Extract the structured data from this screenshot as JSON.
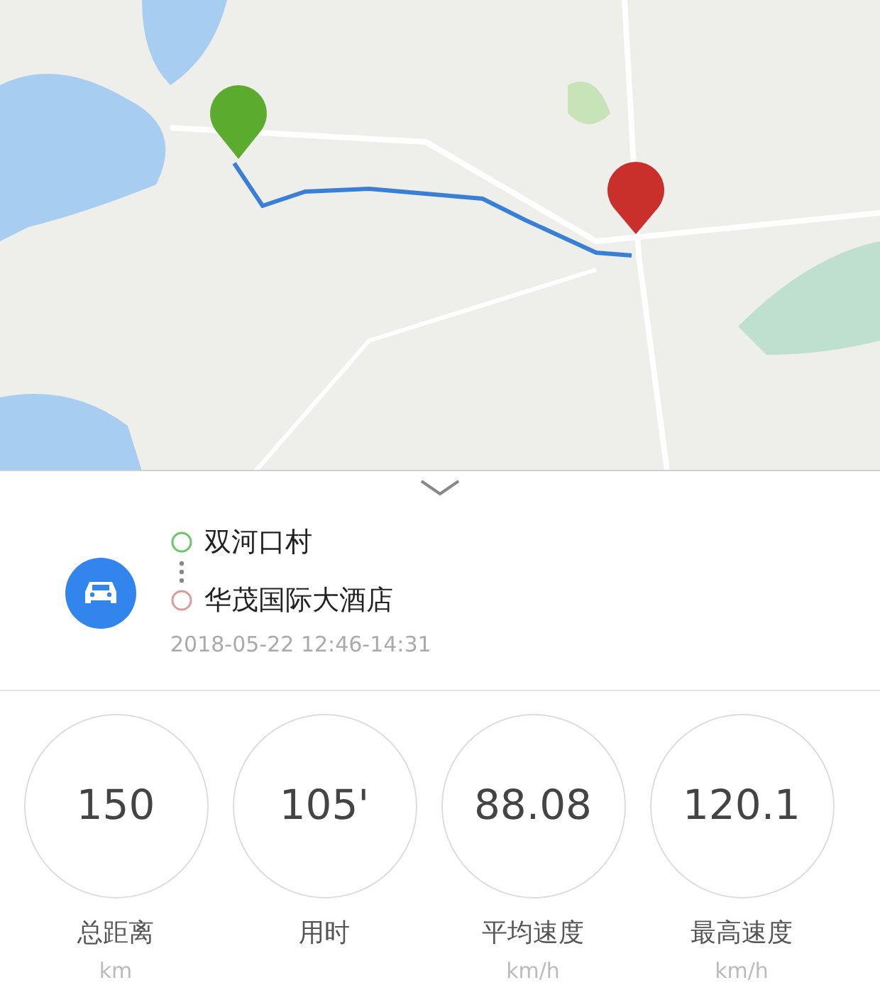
{
  "trip": {
    "start": "双河口村",
    "end": "华茂国际大酒店",
    "time": "2018-05-22 12:46-14:31"
  },
  "stats": [
    {
      "value": "150",
      "label": "总距离",
      "unit": "km"
    },
    {
      "value": "105'",
      "label": "用时"
    },
    {
      "value": "88.08",
      "label": "平均速度",
      "unit": "km/h"
    },
    {
      "value": "120.1",
      "label": "最高速度",
      "unit": "km/h"
    }
  ]
}
